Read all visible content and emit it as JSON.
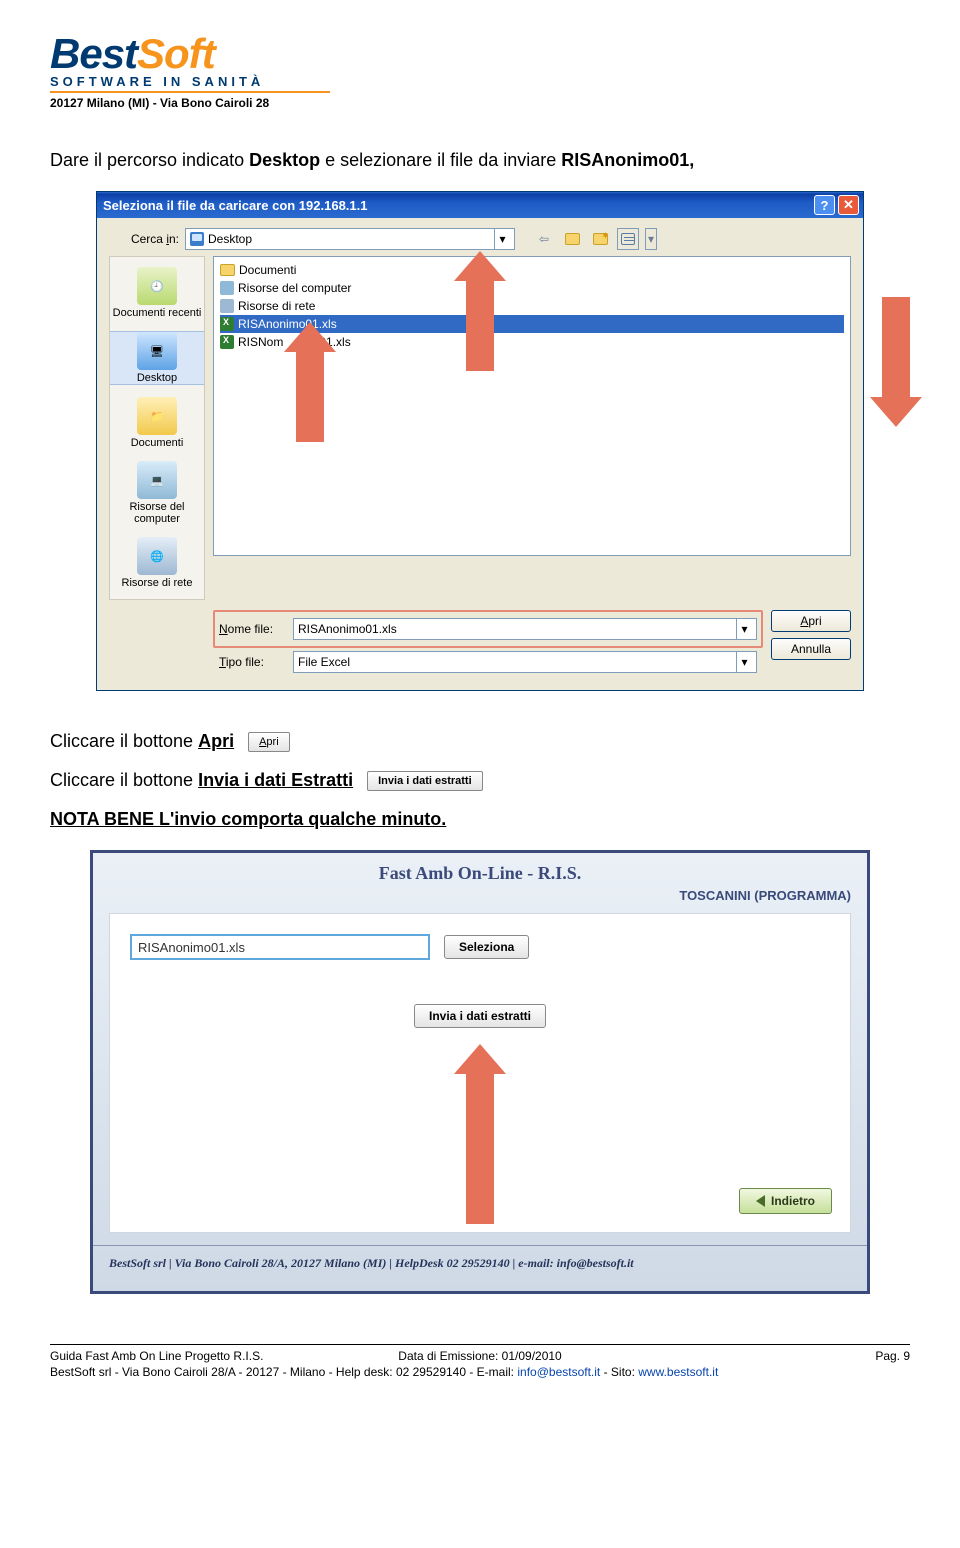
{
  "logo": {
    "part1": "Best",
    "part2": "Soft",
    "subtitle": "SOFTWARE IN SANITÀ",
    "address_header": "20127 Milano (MI) - Via Bono Cairoli 28"
  },
  "intro_text": {
    "prefix": "Dare il percorso indicato ",
    "bold1": "Desktop",
    "mid": " e selezionare il file da inviare ",
    "bold2": "RISAnonimo01,"
  },
  "dialog": {
    "title": "Seleziona il file da caricare con 192.168.1.1",
    "lookin_label_pre": "Cerca ",
    "lookin_label_u": "i",
    "lookin_label_post": "n:",
    "lookin_value": "Desktop",
    "places": {
      "recent": "Documenti recenti",
      "desktop": "Desktop",
      "documents": "Documenti",
      "computer": "Risorse del computer",
      "network": "Risorse di rete"
    },
    "files": {
      "f1": "Documenti",
      "f2": "Risorse del computer",
      "f3": "Risorse di rete",
      "f4": "RISAnonimo01.xls",
      "f5_a": "RISNom",
      "f5_b": "ale01.xls"
    },
    "filename_label_u": "N",
    "filename_label_post": "ome file:",
    "filename_value": "RISAnonimo01.xls",
    "filetype_label_u": "T",
    "filetype_label_post": "ipo file:",
    "filetype_value": "File Excel",
    "open_u": "A",
    "open_post": "pri",
    "cancel": "Annulla"
  },
  "lines": {
    "l1_pre": "Cliccare il bottone ",
    "l1_bold": "Apri",
    "l1_btn": "Apri",
    "l2_pre": "Cliccare il bottone ",
    "l2_bold": "Invia i dati Estratti",
    "l2_btn": "Invia i dati estratti",
    "l3": "NOTA BENE L'invio comporta qualche minuto."
  },
  "web": {
    "title": "Fast Amb On-Line - R.I.S.",
    "user": "TOSCANINI (PROGRAMMA)",
    "input_value": "RISAnonimo01.xls",
    "btn_select": "Seleziona",
    "btn_send": "Invia i dati estratti",
    "btn_back": "Indietro",
    "footer": "BestSoft srl | Via Bono Cairoli 28/A, 20127 Milano (MI) | HelpDesk 02 29529140 | e-mail: info@bestsoft.it"
  },
  "footer": {
    "left": "Guida Fast Amb On Line Progetto R.I.S.",
    "mid": "Data di Emissione: 01/09/2010",
    "right": "Pag. 9",
    "line2_pre": "BestSoft srl - Via Bono Cairoli 28/A - 20127 - Milano - Help desk: 02 29529140 - E-mail: ",
    "email": "info@bestsoft.it",
    "line2_mid": " - Sito: ",
    "site": "www.bestsoft.it"
  }
}
